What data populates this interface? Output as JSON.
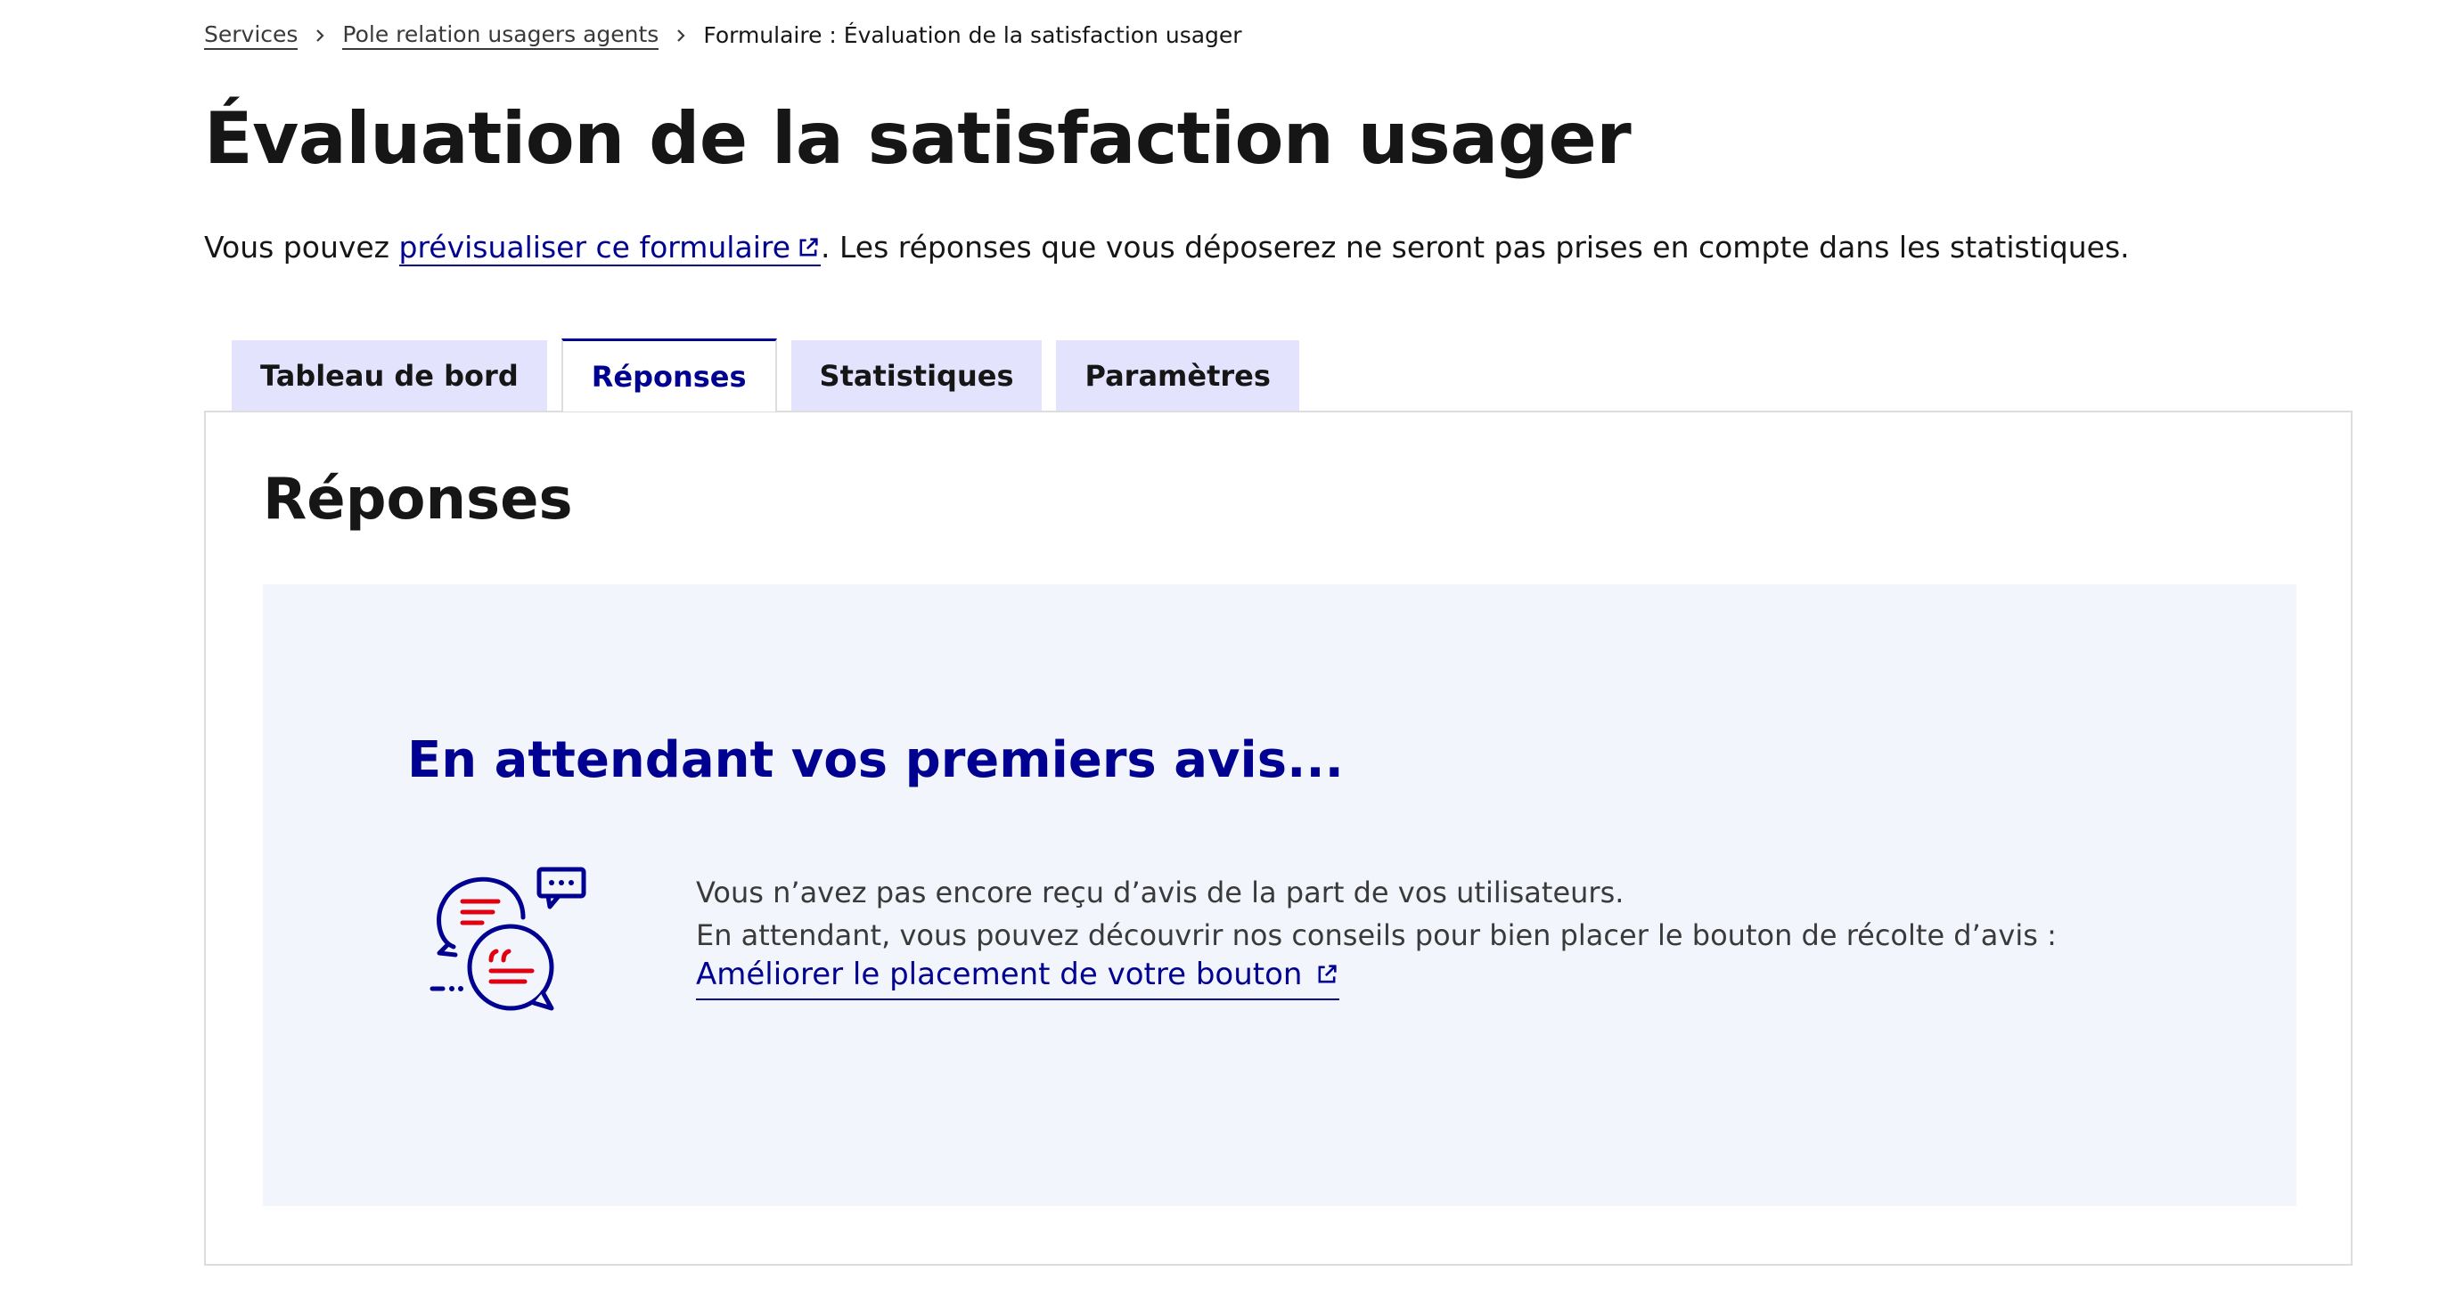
{
  "breadcrumb": {
    "items": [
      {
        "label": "Services"
      },
      {
        "label": "Pole relation usagers agents"
      }
    ],
    "current": "Formulaire : Évaluation de la satisfaction usager"
  },
  "page": {
    "title": "Évaluation de la satisfaction usager",
    "intro_before": "Vous pouvez ",
    "intro_link": "prévisualiser ce formulaire",
    "intro_after": ". Les réponses que vous déposerez ne seront pas prises en compte dans les statistiques."
  },
  "tabs": [
    {
      "label": "Tableau de bord",
      "active": false
    },
    {
      "label": "Réponses",
      "active": true
    },
    {
      "label": "Statistiques",
      "active": false
    },
    {
      "label": "Paramètres",
      "active": false
    }
  ],
  "panel": {
    "title": "Réponses",
    "empty_state": {
      "title": "En attendant vos premiers avis...",
      "line1": "Vous n’avez pas encore reçu d’avis de la part de vos utilisateurs.",
      "line2": "En attendant, vous pouvez découvrir nos conseils pour bien placer le bouton de récolte d’avis :",
      "link": "Améliorer le placement de votre bouton",
      "illustration": "chat-bubbles-illustration"
    }
  },
  "colors": {
    "primary": "#000091",
    "accent_red": "#e1000f",
    "tab_bg": "#e3e3fd",
    "card_bg": "#f3f5fc",
    "border": "#dddddd"
  }
}
